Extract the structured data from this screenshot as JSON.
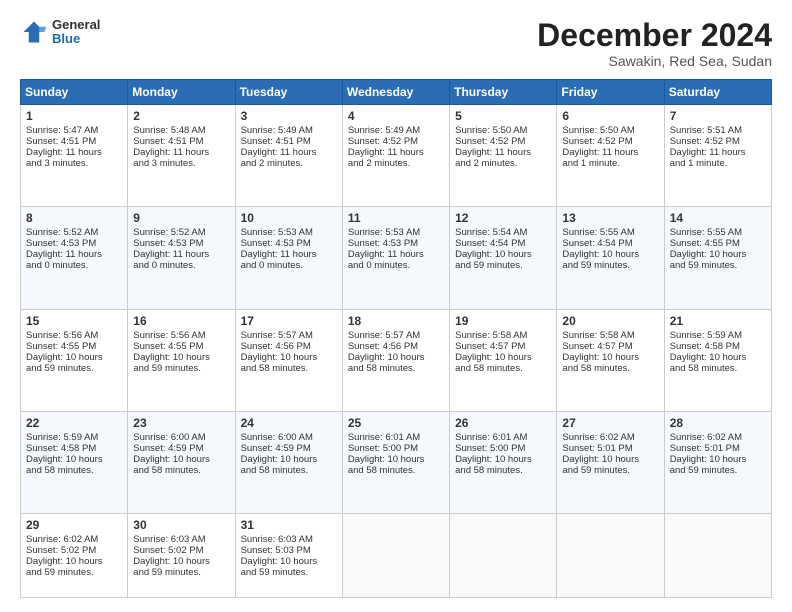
{
  "logo": {
    "general": "General",
    "blue": "Blue"
  },
  "header": {
    "month": "December 2024",
    "location": "Sawakin, Red Sea, Sudan"
  },
  "weekdays": [
    "Sunday",
    "Monday",
    "Tuesday",
    "Wednesday",
    "Thursday",
    "Friday",
    "Saturday"
  ],
  "weeks": [
    [
      {
        "day": 1,
        "lines": [
          "Sunrise: 5:47 AM",
          "Sunset: 4:51 PM",
          "Daylight: 11 hours",
          "and 3 minutes."
        ]
      },
      {
        "day": 2,
        "lines": [
          "Sunrise: 5:48 AM",
          "Sunset: 4:51 PM",
          "Daylight: 11 hours",
          "and 3 minutes."
        ]
      },
      {
        "day": 3,
        "lines": [
          "Sunrise: 5:49 AM",
          "Sunset: 4:51 PM",
          "Daylight: 11 hours",
          "and 2 minutes."
        ]
      },
      {
        "day": 4,
        "lines": [
          "Sunrise: 5:49 AM",
          "Sunset: 4:52 PM",
          "Daylight: 11 hours",
          "and 2 minutes."
        ]
      },
      {
        "day": 5,
        "lines": [
          "Sunrise: 5:50 AM",
          "Sunset: 4:52 PM",
          "Daylight: 11 hours",
          "and 2 minutes."
        ]
      },
      {
        "day": 6,
        "lines": [
          "Sunrise: 5:50 AM",
          "Sunset: 4:52 PM",
          "Daylight: 11 hours",
          "and 1 minute."
        ]
      },
      {
        "day": 7,
        "lines": [
          "Sunrise: 5:51 AM",
          "Sunset: 4:52 PM",
          "Daylight: 11 hours",
          "and 1 minute."
        ]
      }
    ],
    [
      {
        "day": 8,
        "lines": [
          "Sunrise: 5:52 AM",
          "Sunset: 4:53 PM",
          "Daylight: 11 hours",
          "and 0 minutes."
        ]
      },
      {
        "day": 9,
        "lines": [
          "Sunrise: 5:52 AM",
          "Sunset: 4:53 PM",
          "Daylight: 11 hours",
          "and 0 minutes."
        ]
      },
      {
        "day": 10,
        "lines": [
          "Sunrise: 5:53 AM",
          "Sunset: 4:53 PM",
          "Daylight: 11 hours",
          "and 0 minutes."
        ]
      },
      {
        "day": 11,
        "lines": [
          "Sunrise: 5:53 AM",
          "Sunset: 4:53 PM",
          "Daylight: 11 hours",
          "and 0 minutes."
        ]
      },
      {
        "day": 12,
        "lines": [
          "Sunrise: 5:54 AM",
          "Sunset: 4:54 PM",
          "Daylight: 10 hours",
          "and 59 minutes."
        ]
      },
      {
        "day": 13,
        "lines": [
          "Sunrise: 5:55 AM",
          "Sunset: 4:54 PM",
          "Daylight: 10 hours",
          "and 59 minutes."
        ]
      },
      {
        "day": 14,
        "lines": [
          "Sunrise: 5:55 AM",
          "Sunset: 4:55 PM",
          "Daylight: 10 hours",
          "and 59 minutes."
        ]
      }
    ],
    [
      {
        "day": 15,
        "lines": [
          "Sunrise: 5:56 AM",
          "Sunset: 4:55 PM",
          "Daylight: 10 hours",
          "and 59 minutes."
        ]
      },
      {
        "day": 16,
        "lines": [
          "Sunrise: 5:56 AM",
          "Sunset: 4:55 PM",
          "Daylight: 10 hours",
          "and 59 minutes."
        ]
      },
      {
        "day": 17,
        "lines": [
          "Sunrise: 5:57 AM",
          "Sunset: 4:56 PM",
          "Daylight: 10 hours",
          "and 58 minutes."
        ]
      },
      {
        "day": 18,
        "lines": [
          "Sunrise: 5:57 AM",
          "Sunset: 4:56 PM",
          "Daylight: 10 hours",
          "and 58 minutes."
        ]
      },
      {
        "day": 19,
        "lines": [
          "Sunrise: 5:58 AM",
          "Sunset: 4:57 PM",
          "Daylight: 10 hours",
          "and 58 minutes."
        ]
      },
      {
        "day": 20,
        "lines": [
          "Sunrise: 5:58 AM",
          "Sunset: 4:57 PM",
          "Daylight: 10 hours",
          "and 58 minutes."
        ]
      },
      {
        "day": 21,
        "lines": [
          "Sunrise: 5:59 AM",
          "Sunset: 4:58 PM",
          "Daylight: 10 hours",
          "and 58 minutes."
        ]
      }
    ],
    [
      {
        "day": 22,
        "lines": [
          "Sunrise: 5:59 AM",
          "Sunset: 4:58 PM",
          "Daylight: 10 hours",
          "and 58 minutes."
        ]
      },
      {
        "day": 23,
        "lines": [
          "Sunrise: 6:00 AM",
          "Sunset: 4:59 PM",
          "Daylight: 10 hours",
          "and 58 minutes."
        ]
      },
      {
        "day": 24,
        "lines": [
          "Sunrise: 6:00 AM",
          "Sunset: 4:59 PM",
          "Daylight: 10 hours",
          "and 58 minutes."
        ]
      },
      {
        "day": 25,
        "lines": [
          "Sunrise: 6:01 AM",
          "Sunset: 5:00 PM",
          "Daylight: 10 hours",
          "and 58 minutes."
        ]
      },
      {
        "day": 26,
        "lines": [
          "Sunrise: 6:01 AM",
          "Sunset: 5:00 PM",
          "Daylight: 10 hours",
          "and 58 minutes."
        ]
      },
      {
        "day": 27,
        "lines": [
          "Sunrise: 6:02 AM",
          "Sunset: 5:01 PM",
          "Daylight: 10 hours",
          "and 59 minutes."
        ]
      },
      {
        "day": 28,
        "lines": [
          "Sunrise: 6:02 AM",
          "Sunset: 5:01 PM",
          "Daylight: 10 hours",
          "and 59 minutes."
        ]
      }
    ],
    [
      {
        "day": 29,
        "lines": [
          "Sunrise: 6:02 AM",
          "Sunset: 5:02 PM",
          "Daylight: 10 hours",
          "and 59 minutes."
        ]
      },
      {
        "day": 30,
        "lines": [
          "Sunrise: 6:03 AM",
          "Sunset: 5:02 PM",
          "Daylight: 10 hours",
          "and 59 minutes."
        ]
      },
      {
        "day": 31,
        "lines": [
          "Sunrise: 6:03 AM",
          "Sunset: 5:03 PM",
          "Daylight: 10 hours",
          "and 59 minutes."
        ]
      },
      null,
      null,
      null,
      null
    ]
  ]
}
